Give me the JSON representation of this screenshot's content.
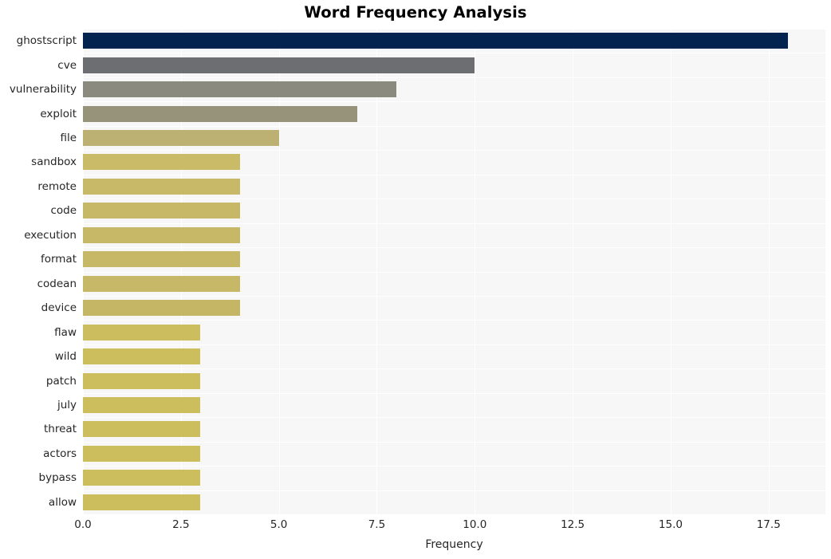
{
  "chart_data": {
    "type": "bar",
    "orientation": "horizontal",
    "title": "Word Frequency Analysis",
    "xlabel": "Frequency",
    "ylabel": "",
    "categories": [
      "ghostscript",
      "cve",
      "vulnerability",
      "exploit",
      "file",
      "sandbox",
      "remote",
      "code",
      "execution",
      "format",
      "codean",
      "device",
      "flaw",
      "wild",
      "patch",
      "july",
      "threat",
      "actors",
      "bypass",
      "allow"
    ],
    "values": [
      18,
      10,
      8,
      7,
      5,
      4,
      4,
      4,
      4,
      4,
      4,
      4,
      3,
      3,
      3,
      3,
      3,
      3,
      3,
      3
    ],
    "bar_colors": [
      "#042450",
      "#6d6e72",
      "#8a8a7e",
      "#97937a",
      "#bcb072",
      "#c9bb68",
      "#c7b967",
      "#c6b866",
      "#c6b866",
      "#c6b866",
      "#c6b866",
      "#c4b665",
      "#ccbd5f",
      "#cdbe5d",
      "#cdbe5d",
      "#cdbe5d",
      "#cdbe5d",
      "#cdbe5d",
      "#cdbe5d",
      "#cdbe5d"
    ],
    "xlim": [
      0,
      18.95
    ],
    "xticks": [
      0.0,
      2.5,
      5.0,
      7.5,
      10.0,
      12.5,
      15.0,
      17.5
    ],
    "xtick_labels": [
      "0.0",
      "2.5",
      "5.0",
      "7.5",
      "10.0",
      "12.5",
      "15.0",
      "17.5"
    ],
    "grid": true,
    "grid_color": "#ffffff",
    "plot_background": "#f7f7f7",
    "figure_background": "#ffffff",
    "legend": null
  }
}
